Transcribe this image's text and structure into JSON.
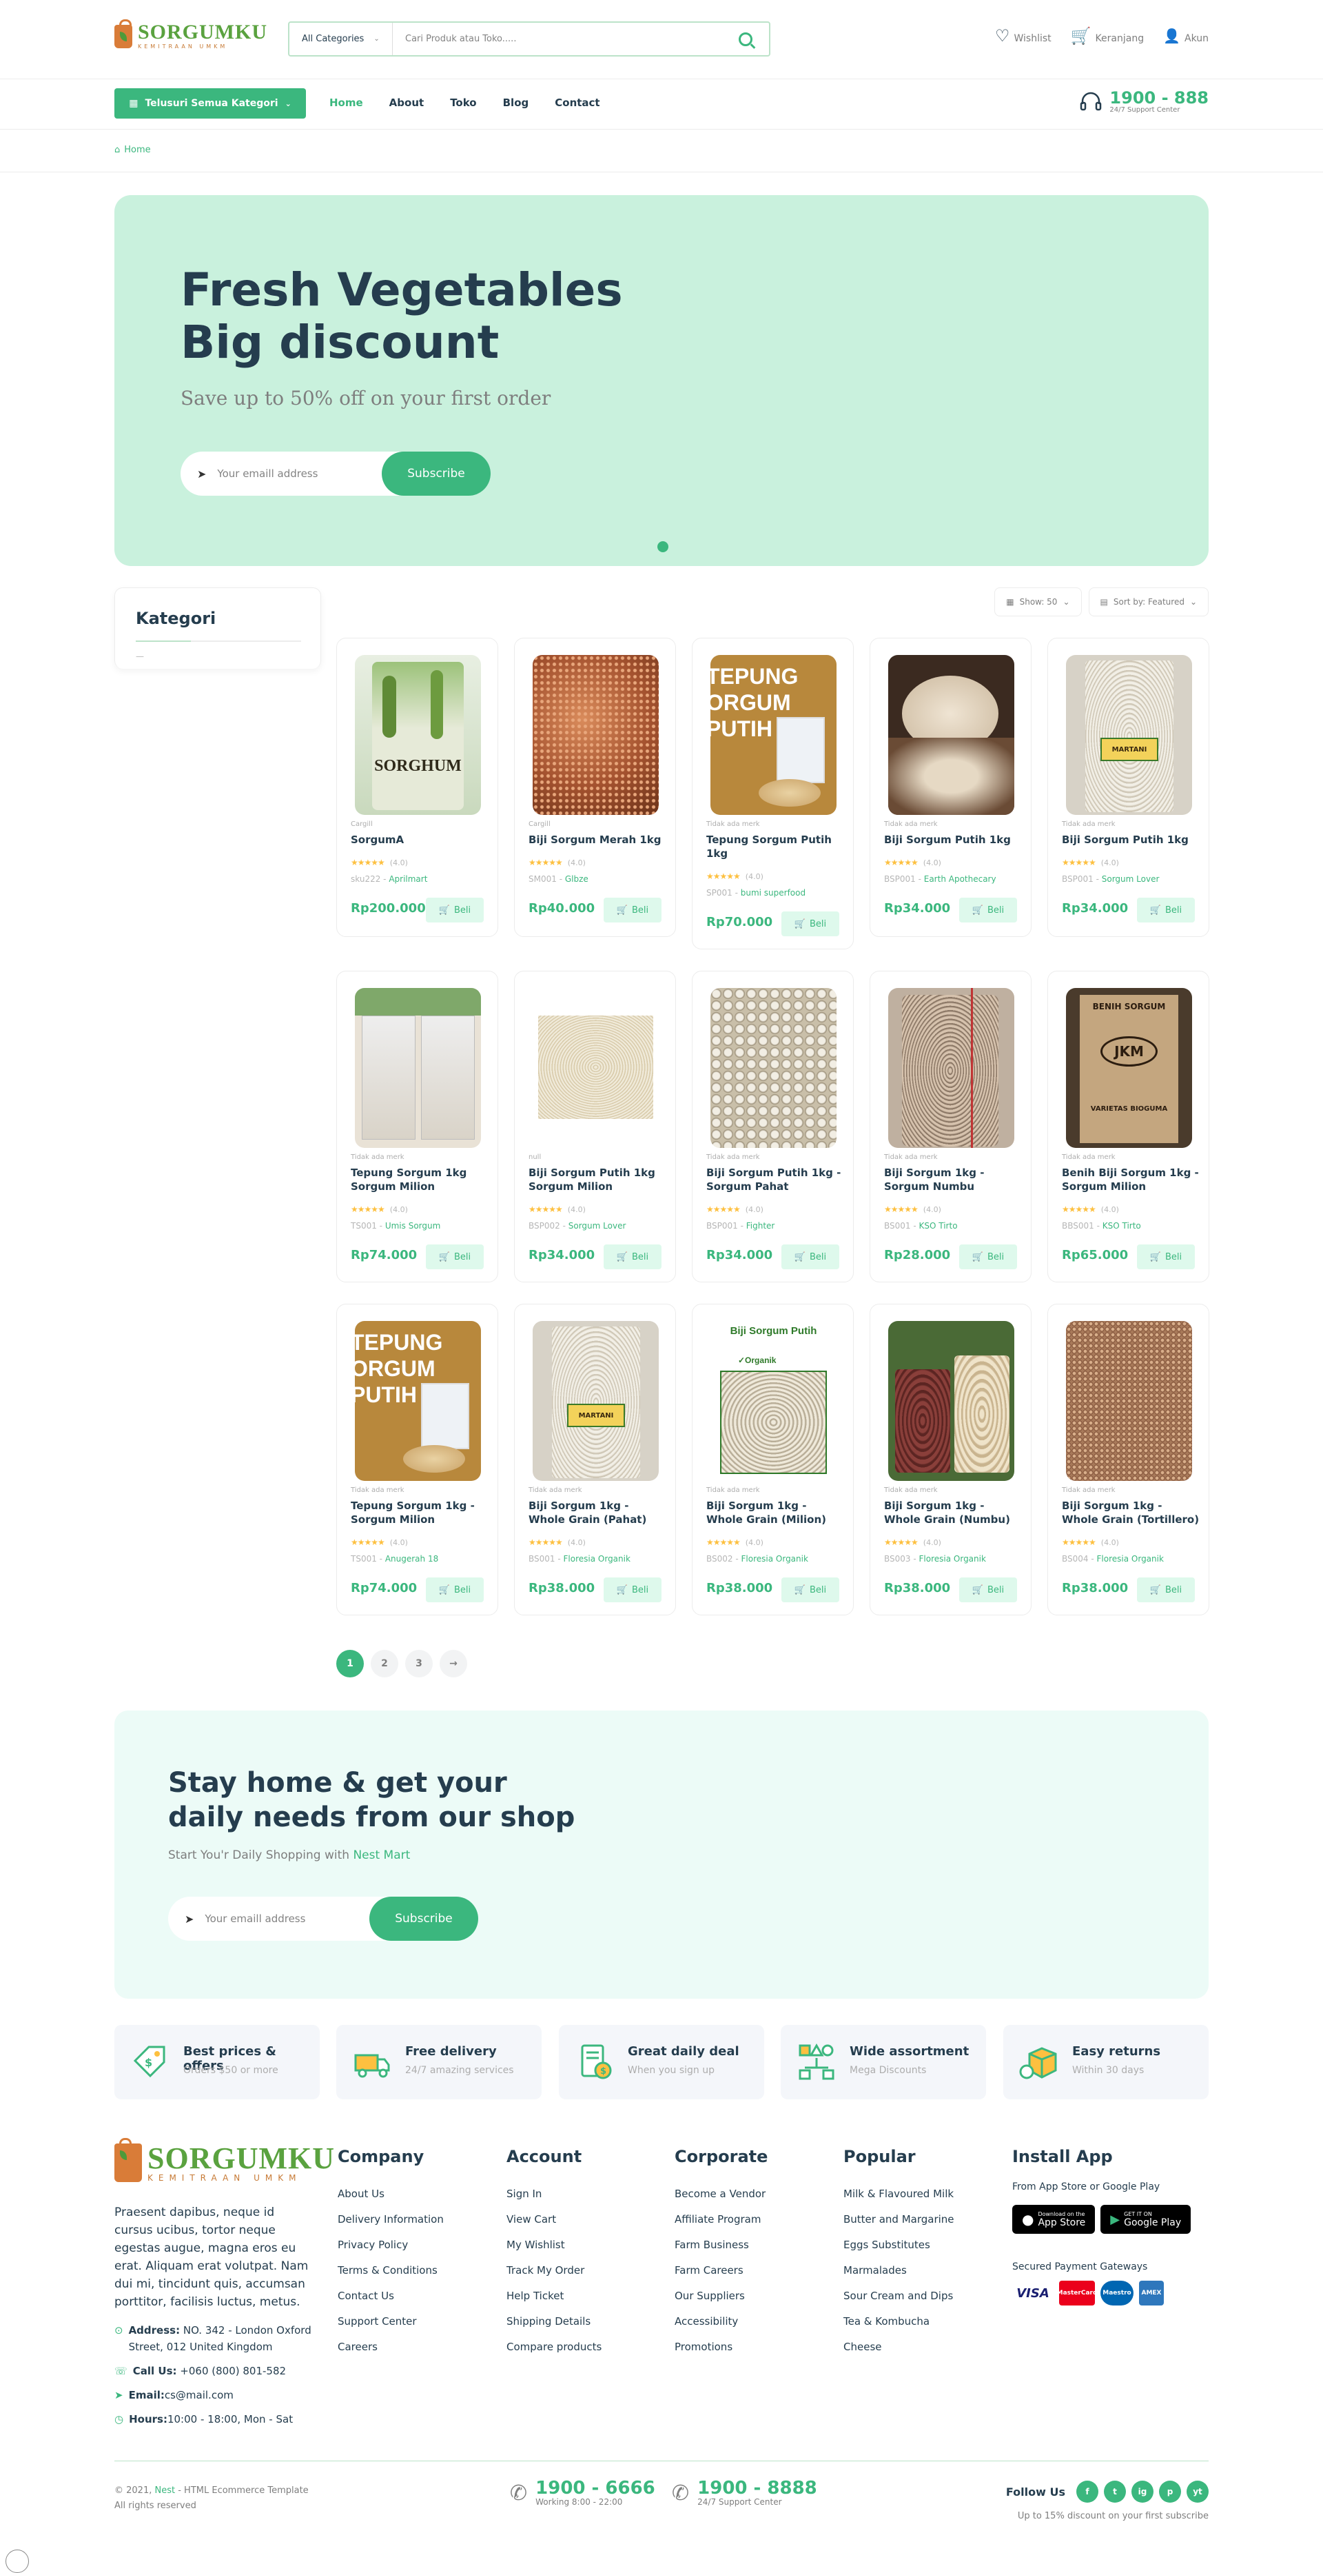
{
  "header": {
    "logo_name": "SORGUMKU",
    "logo_sub": "KEMITRAAN UMKM",
    "search_category": "All Categories",
    "search_placeholder": "Cari Produk atau Toko.....",
    "wishlist": "Wishlist",
    "cart": "Keranjang",
    "account": "Akun"
  },
  "nav": {
    "browse": "Telusuri Semua Kategori",
    "items": [
      "Home",
      "About",
      "Toko",
      "Blog",
      "Contact"
    ],
    "hotline": "1900 - 888",
    "hotline_sub": "24/7 Support Center"
  },
  "breadcrumb": "Home",
  "hero": {
    "title_line1": "Fresh Vegetables",
    "title_line2": "Big discount",
    "subtitle": "Save up to 50% off on your first order",
    "email_placeholder": "Your emaill address",
    "button": "Subscribe"
  },
  "sidebar": {
    "title": "Kategori"
  },
  "filters": {
    "show": "Show: 50",
    "sort": "Sort by: Featured"
  },
  "products": [
    {
      "cat": "Cargill",
      "name": "SorgumA",
      "rating": "(4.0)",
      "sku": "sku222",
      "by": "Aprilmart",
      "price": "Rp200.000",
      "img": "sorghum-bag"
    },
    {
      "cat": "Cargill",
      "name": "Biji Sorgum Merah 1kg",
      "rating": "(4.0)",
      "sku": "SM001",
      "by": "Glbze",
      "price": "Rp40.000",
      "img": "red-grains"
    },
    {
      "cat": "Tidak ada merk",
      "name": "Tepung Sorgum Putih 1kg",
      "rating": "(4.0)",
      "sku": "SP001",
      "by": "bumi superfood",
      "price": "Rp70.000",
      "img": "tepung"
    },
    {
      "cat": "Tidak ada merk",
      "name": "Biji Sorgum Putih 1kg",
      "rating": "(4.0)",
      "sku": "BSP001",
      "by": "Earth Apothecary",
      "price": "Rp34.000",
      "img": "white-bowl"
    },
    {
      "cat": "Tidak ada merk",
      "name": "Biji Sorgum Putih 1kg",
      "rating": "(4.0)",
      "sku": "BSP001",
      "by": "Sorgum Lover",
      "price": "Rp34.000",
      "img": "martani"
    },
    {
      "cat": "Tidak ada merk",
      "name": "Tepung Sorgum 1kg Sorgum Milion",
      "rating": "(4.0)",
      "sku": "TS001",
      "by": "Umis Sorgum",
      "price": "Rp74.000",
      "img": "two-bags"
    },
    {
      "cat": "null",
      "name": "Biji Sorgum Putih 1kg Sorgum Milion",
      "rating": "(4.0)",
      "sku": "BSP002",
      "by": "Sorgum Lover",
      "price": "Rp34.000",
      "img": "white-grain"
    },
    {
      "cat": "Tidak ada merk",
      "name": "Biji Sorgum Putih 1kg - Sorgum Pahat",
      "rating": "(4.0)",
      "sku": "BSP001",
      "by": "Fighter",
      "price": "Rp34.000",
      "img": "white-seeds"
    },
    {
      "cat": "Tidak ada merk",
      "name": "Biji Sorgum 1kg - Sorgum Numbu",
      "rating": "(4.0)",
      "sku": "BS001",
      "by": "KSO Tirto",
      "price": "Rp28.000",
      "img": "sack"
    },
    {
      "cat": "Tidak ada merk",
      "name": "Benih Biji Sorgum 1kg - Sorgum Milion",
      "rating": "(4.0)",
      "sku": "BBS001",
      "by": "KSO Tirto",
      "price": "Rp65.000",
      "img": "benih"
    },
    {
      "cat": "Tidak ada merk",
      "name": "Tepung Sorgum 1kg - Sorgum Milion",
      "rating": "(4.0)",
      "sku": "TS001",
      "by": "Anugerah 18",
      "price": "Rp74.000",
      "img": "tepung"
    },
    {
      "cat": "Tidak ada merk",
      "name": "Biji Sorgum 1kg - Whole Grain (Pahat)",
      "rating": "(4.0)",
      "sku": "BS001",
      "by": "Floresia Organik",
      "price": "Rp38.000",
      "img": "martani"
    },
    {
      "cat": "Tidak ada merk",
      "name": "Biji Sorgum 1kg - Whole Grain (Milion)",
      "rating": "(4.0)",
      "sku": "BS002",
      "by": "Floresia Organik",
      "price": "Rp38.000",
      "img": "organik"
    },
    {
      "cat": "Tidak ada merk",
      "name": "Biji Sorgum 1kg - Whole Grain (Numbu)",
      "rating": "(4.0)",
      "sku": "BS003",
      "by": "Floresia Organik",
      "price": "Rp38.000",
      "img": "jars"
    },
    {
      "cat": "Tidak ada merk",
      "name": "Biji Sorgum 1kg - Whole Grain (Tortillero)",
      "rating": "(4.0)",
      "sku": "BS004",
      "by": "Floresia Organik",
      "price": "Rp38.000",
      "img": "brown-grain"
    }
  ],
  "image_texts": {
    "sorghum": "SORGHUM",
    "tepung": "TEPUNG",
    "sorgum": "ORGUM",
    "putih": "PUTIH",
    "martani": "MARTANI",
    "benih": "BENIH SORGUM",
    "jkm": "JKM",
    "varietas": "VARIETAS BIOGUMA",
    "organik_title": "Biji Sorgum Putih",
    "organik_badge": "Organik"
  },
  "add_label": "Beli",
  "pagination": [
    "1",
    "2",
    "3",
    "→"
  ],
  "newsletter": {
    "title": "Stay home & get your daily needs from our shop",
    "subtitle_pre": "Start You'r Daily Shopping with",
    "subtitle_brand": "Nest Mart",
    "email_placeholder": "Your emaill address",
    "button": "Subscribe"
  },
  "features": [
    {
      "title": "Best prices & offers",
      "sub": "Orders $50 or more",
      "icon": "price-tag-icon"
    },
    {
      "title": "Free delivery",
      "sub": "24/7 amazing services",
      "icon": "delivery-icon"
    },
    {
      "title": "Great daily deal",
      "sub": "When you sign up",
      "icon": "deal-icon"
    },
    {
      "title": "Wide assortment",
      "sub": "Mega Discounts",
      "icon": "assortment-icon"
    },
    {
      "title": "Easy returns",
      "sub": "Within 30 days",
      "icon": "returns-icon"
    }
  ],
  "footer": {
    "about": "Praesent dapibus, neque id cursus ucibus, tortor neque egestas augue, magna eros eu erat. Aliquam erat volutpat. Nam dui mi, tincidunt quis, accumsan porttitor, facilisis luctus, metus.",
    "address_label": "Address:",
    "address": "NO. 342 - London Oxford Street, 012 United Kingdom",
    "call_label": "Call Us:",
    "call": "+060 (800) 801-582",
    "email_label": "Email:",
    "email": "cs@mail.com",
    "hours_label": "Hours:",
    "hours": "10:00 - 18:00, Mon - Sat",
    "columns": [
      {
        "title": "Company",
        "links": [
          "About Us",
          "Delivery Information",
          "Privacy Policy",
          "Terms & Conditions",
          "Contact Us",
          "Support Center",
          "Careers"
        ]
      },
      {
        "title": "Account",
        "links": [
          "Sign In",
          "View Cart",
          "My Wishlist",
          "Track My Order",
          "Help Ticket",
          "Shipping Details",
          "Compare products"
        ]
      },
      {
        "title": "Corporate",
        "links": [
          "Become a Vendor",
          "Affiliate Program",
          "Farm Business",
          "Farm Careers",
          "Our Suppliers",
          "Accessibility",
          "Promotions"
        ]
      },
      {
        "title": "Popular",
        "links": [
          "Milk & Flavoured Milk",
          "Butter and Margarine",
          "Eggs Substitutes",
          "Marmalades",
          "Sour Cream and Dips",
          "Tea & Kombucha",
          "Cheese"
        ]
      }
    ],
    "install_title": "Install App",
    "install_sub": "From App Store or Google Play",
    "appstore_small": "Download on the",
    "appstore": "App Store",
    "gplay_small": "GET IT ON",
    "gplay": "Google Play",
    "payment_title": "Secured Payment Gateways",
    "payments": [
      "VISA",
      "MasterCard",
      "Maestro",
      "AMEX"
    ],
    "copyright_pre": "© 2021,",
    "copyright_brand": "Nest",
    "copyright_post": "- HTML Ecommerce Template",
    "rights": "All rights reserved",
    "hotline1": "1900 - 6666",
    "hotline1_sub": "Working 8:00 - 22:00",
    "hotline2": "1900 - 8888",
    "hotline2_sub": "24/7 Support Center",
    "follow": "Follow Us",
    "discount": "Up to 15% discount on your first subscribe",
    "socials": [
      "f",
      "t",
      "ig",
      "p",
      "yt"
    ]
  },
  "colors": {
    "brand": "#3bb77e",
    "hero_bg": "#c9f1dd",
    "news_bg": "#ecfbf7",
    "star": "#fdc040"
  }
}
